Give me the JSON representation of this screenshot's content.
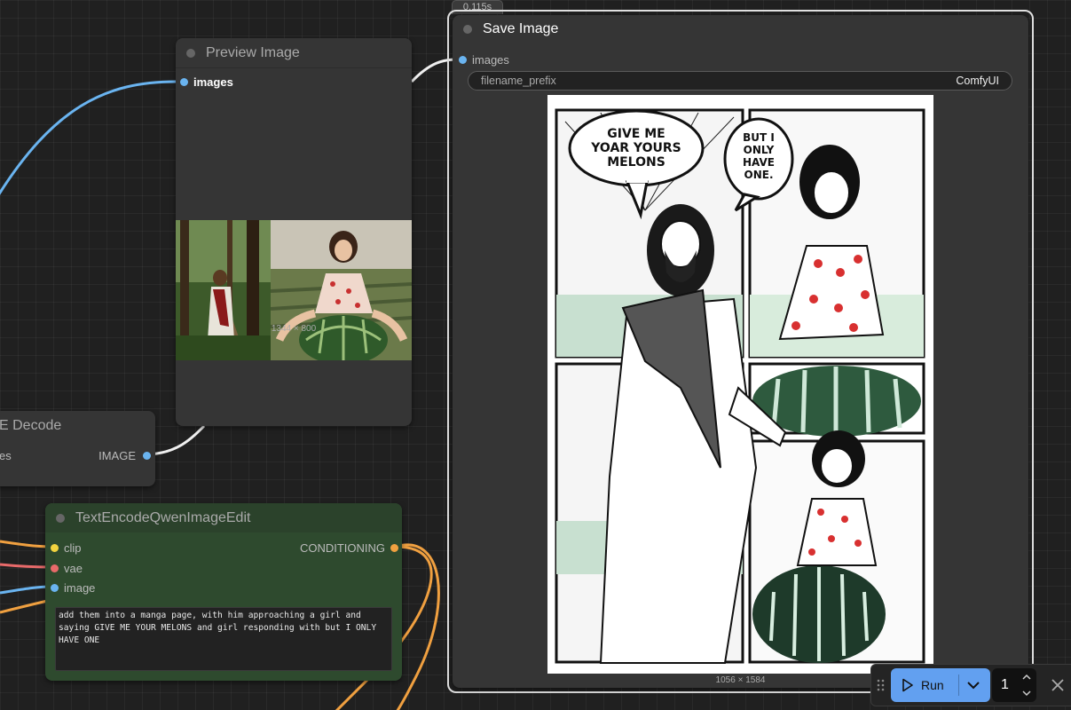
{
  "colors": {
    "canvas": "#202020",
    "node_bg": "#353535",
    "encode_bg": "#2e4a2e",
    "run_accent": "#62a0f0",
    "image_slot": "#6ab4f0",
    "clip_slot": "#f2d33f",
    "vae_slot": "#e86a6a",
    "conditioning_slot": "#f0a040"
  },
  "preview_node": {
    "title": "Preview Image",
    "input_label": "images",
    "image_dims": "1344 × 800"
  },
  "decode_node": {
    "title": "E Decode",
    "input_label": "es",
    "output_label": "IMAGE"
  },
  "encode_node": {
    "title": "TextEncodeQwenImageEdit",
    "inputs": [
      "clip",
      "vae",
      "image"
    ],
    "output_label": "CONDITIONING",
    "prompt": "add them into a manga page, with him approaching a girl and saying GIVE ME YOUR MELONS and girl responding with but I ONLY HAVE ONE"
  },
  "save_node": {
    "timing": "0.115s",
    "title": "Save Image",
    "input_label": "images",
    "widget_label": "filename_prefix",
    "widget_value": "ComfyUI",
    "image_dims": "1056 × 1584"
  },
  "manga": {
    "bubble_left": [
      "GIVE ME",
      "YOAR YOURS",
      "MELONS"
    ],
    "bubble_right": [
      "BUT I",
      "ONLY",
      "HAVE",
      "ONE."
    ]
  },
  "toolbar": {
    "run_label": "Run",
    "batch_count": "1"
  },
  "icons": {
    "drag": "drag-handle-icon",
    "play": "play-icon",
    "chevron": "chevron-down-icon",
    "stepper_up": "chevron-up-icon",
    "stepper_down": "chevron-down-icon",
    "close": "close-icon"
  }
}
